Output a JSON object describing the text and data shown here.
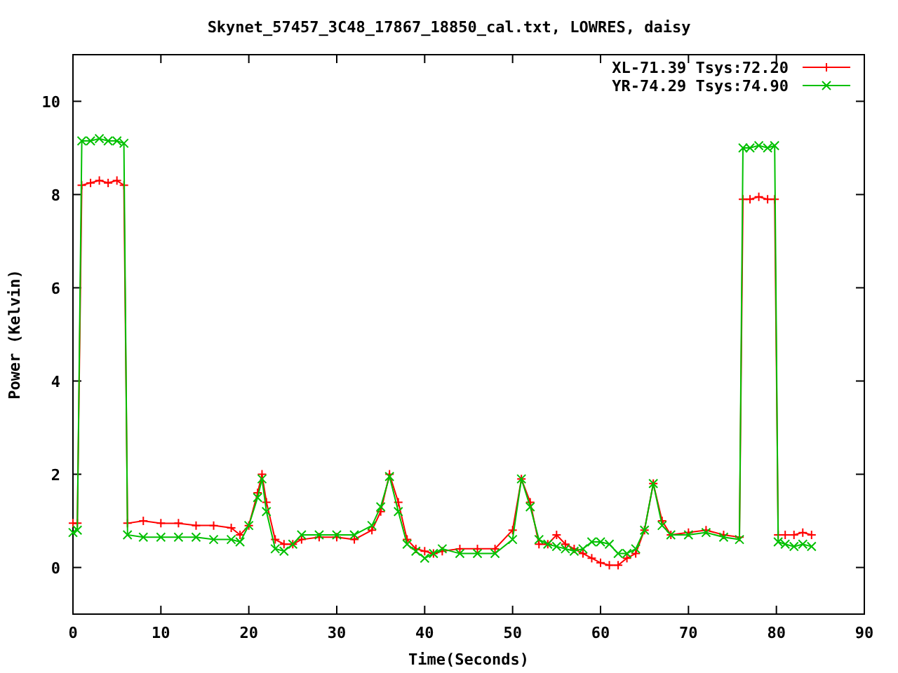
{
  "chart": {
    "chart_data": {
      "type": "line",
      "title": "Skynet_57457_3C48_17867_18850_cal.txt, LOWRES, daisy",
      "xlabel": "Time(Seconds)",
      "ylabel": "Power (Kelvin)",
      "x": [
        0,
        0.5,
        1,
        2,
        3,
        4,
        5,
        5.8,
        6.2,
        8,
        10,
        12,
        14,
        16,
        18,
        19,
        20,
        21,
        21.5,
        22,
        23,
        24,
        25,
        26,
        28,
        30,
        32,
        34,
        35,
        36,
        37,
        38,
        39,
        40,
        41,
        42,
        44,
        46,
        48,
        50,
        51,
        52,
        53,
        54,
        55,
        56,
        57,
        58,
        59,
        60,
        61,
        62,
        63,
        64,
        65,
        66,
        67,
        68,
        70,
        72,
        74,
        75.8,
        76.2,
        77,
        78,
        79,
        79.8,
        80.2,
        81,
        82,
        83,
        84
      ],
      "series": [
        {
          "name": "XL-71.39 Tsys:72.20",
          "color": "#ff0000",
          "marker": "plus",
          "values": [
            0.95,
            0.95,
            8.2,
            8.25,
            8.3,
            8.25,
            8.3,
            8.2,
            0.95,
            1.0,
            0.95,
            0.95,
            0.9,
            0.9,
            0.85,
            0.7,
            0.9,
            1.6,
            2.0,
            1.4,
            0.6,
            0.5,
            0.5,
            0.6,
            0.65,
            0.65,
            0.6,
            0.8,
            1.2,
            2.0,
            1.4,
            0.6,
            0.4,
            0.35,
            0.3,
            0.35,
            0.4,
            0.4,
            0.4,
            0.8,
            1.9,
            1.4,
            0.5,
            0.5,
            0.7,
            0.5,
            0.4,
            0.3,
            0.2,
            0.1,
            0.05,
            0.05,
            0.2,
            0.3,
            0.8,
            1.8,
            1.0,
            0.7,
            0.75,
            0.8,
            0.7,
            0.65,
            7.9,
            7.9,
            7.95,
            7.9,
            7.9,
            0.7,
            0.7,
            0.7,
            0.75,
            0.7
          ]
        },
        {
          "name": "YR-74.29 Tsys:74.90",
          "color": "#00c000",
          "marker": "cross",
          "values": [
            0.75,
            0.8,
            9.15,
            9.15,
            9.2,
            9.15,
            9.15,
            9.1,
            0.7,
            0.65,
            0.65,
            0.65,
            0.65,
            0.6,
            0.6,
            0.55,
            0.9,
            1.5,
            1.9,
            1.2,
            0.4,
            0.35,
            0.5,
            0.7,
            0.7,
            0.7,
            0.7,
            0.9,
            1.3,
            1.95,
            1.2,
            0.5,
            0.35,
            0.2,
            0.3,
            0.4,
            0.3,
            0.3,
            0.3,
            0.6,
            1.9,
            1.3,
            0.6,
            0.5,
            0.45,
            0.4,
            0.35,
            0.4,
            0.55,
            0.55,
            0.5,
            0.3,
            0.3,
            0.4,
            0.8,
            1.8,
            0.9,
            0.7,
            0.7,
            0.75,
            0.65,
            0.6,
            9.0,
            9.0,
            9.05,
            9.0,
            9.05,
            0.55,
            0.5,
            0.45,
            0.5,
            0.45
          ]
        }
      ],
      "legend": "upper right",
      "xlim": [
        0,
        90
      ],
      "ylim": [
        -1,
        11
      ],
      "xticks": [
        0,
        10,
        20,
        30,
        40,
        50,
        60,
        70,
        80,
        90
      ],
      "yticks": [
        0,
        2,
        4,
        6,
        8,
        10
      ]
    }
  }
}
